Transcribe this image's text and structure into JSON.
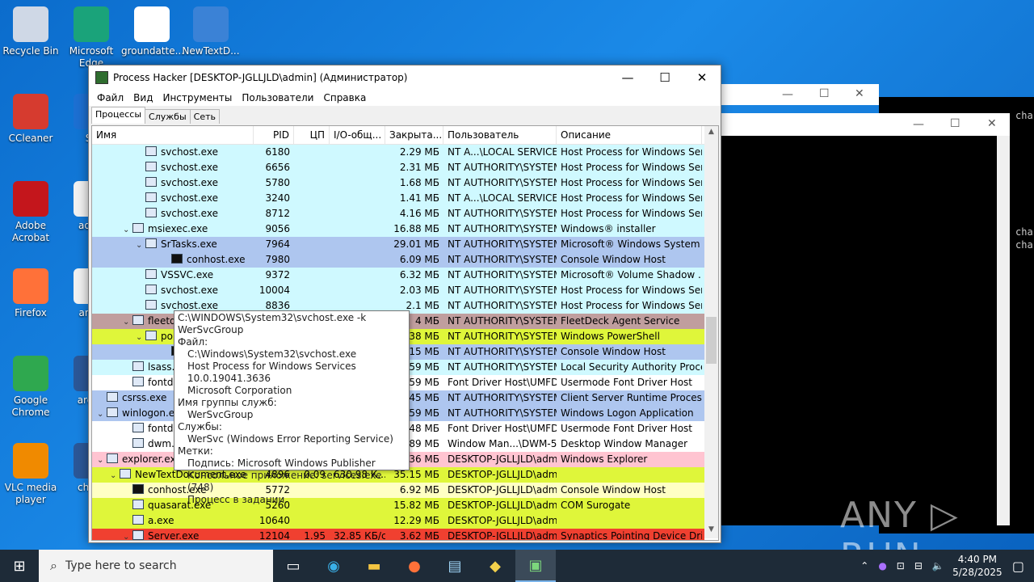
{
  "desktop": {
    "icons": [
      {
        "label": "Recycle Bin",
        "color": "#cfd8e6"
      },
      {
        "label": "Microsoft Edge",
        "color": "#1aa37a"
      },
      {
        "label": "groundatte...",
        "color": "#ffffff"
      },
      {
        "label": "NewTextD...",
        "color": "#3b82d6"
      },
      {
        "label": "CCleaner",
        "color": "#d63b2f"
      },
      {
        "label": "Sk",
        "color": "#1c6fd1"
      },
      {
        "label": "Adobe Acrobat",
        "color": "#c4161c"
      },
      {
        "label": "advic",
        "color": "#f0f0f0"
      },
      {
        "label": "Firefox",
        "color": "#ff7139"
      },
      {
        "label": "answ",
        "color": "#f0f0f0"
      },
      {
        "label": "Google Chrome",
        "color": "#2fa84f"
      },
      {
        "label": "aroun",
        "color": "#2b5797"
      },
      {
        "label": "VLC media player",
        "color": "#f08a00"
      },
      {
        "label": "charg",
        "color": "#2b5797"
      }
    ],
    "console_text": [
      "cha",
      "cha",
      "cha"
    ]
  },
  "window": {
    "title": "Process Hacker [DESKTOP-JGLLJLD\\admin] (Администратор)",
    "controls": {
      "minimize": "—",
      "maximize": "☐",
      "close": "✕"
    },
    "menu": [
      "Файл",
      "Вид",
      "Инструменты",
      "Пользователи",
      "Справка"
    ],
    "tabs": [
      "Процессы",
      "Службы",
      "Сеть"
    ],
    "columns": [
      "Имя",
      "PID",
      "ЦП",
      "I/O-общ...",
      "Закрыта...",
      "Пользователь",
      "Описание"
    ]
  },
  "rows": [
    {
      "name": "svchost.exe",
      "indent": 3,
      "exp": "",
      "pid": "6180",
      "cpu": "",
      "io": "",
      "mem": "2.29 МБ",
      "user": "NT A...\\LOCAL SERVICE",
      "desc": "Host Process for Windows Ser...",
      "bg": "#cff9ff",
      "icon": "svc"
    },
    {
      "name": "svchost.exe",
      "indent": 3,
      "exp": "",
      "pid": "6656",
      "cpu": "",
      "io": "",
      "mem": "2.31 МБ",
      "user": "NT AUTHORITY\\SYSTEM",
      "desc": "Host Process for Windows Ser...",
      "bg": "#cff9ff",
      "icon": "svc"
    },
    {
      "name": "svchost.exe",
      "indent": 3,
      "exp": "",
      "pid": "5780",
      "cpu": "",
      "io": "",
      "mem": "1.68 МБ",
      "user": "NT AUTHORITY\\SYSTEM",
      "desc": "Host Process for Windows Ser...",
      "bg": "#cff9ff",
      "icon": "svc"
    },
    {
      "name": "svchost.exe",
      "indent": 3,
      "exp": "",
      "pid": "3240",
      "cpu": "",
      "io": "",
      "mem": "1.41 МБ",
      "user": "NT A...\\LOCAL SERVICE",
      "desc": "Host Process for Windows Ser...",
      "bg": "#cff9ff",
      "icon": "svc"
    },
    {
      "name": "svchost.exe",
      "indent": 3,
      "exp": "",
      "pid": "8712",
      "cpu": "",
      "io": "",
      "mem": "4.16 МБ",
      "user": "NT AUTHORITY\\SYSTEM",
      "desc": "Host Process for Windows Ser...",
      "bg": "#cff9ff",
      "icon": "svc"
    },
    {
      "name": "msiexec.exe",
      "indent": 2,
      "exp": "v",
      "pid": "9056",
      "cpu": "",
      "io": "",
      "mem": "16.88 МБ",
      "user": "NT AUTHORITY\\SYSTEM",
      "desc": "Windows® installer",
      "bg": "#cff9ff",
      "icon": "svc"
    },
    {
      "name": "SrTasks.exe",
      "indent": 3,
      "exp": "v",
      "pid": "7964",
      "cpu": "",
      "io": "",
      "mem": "29.01 МБ",
      "user": "NT AUTHORITY\\SYSTEM",
      "desc": "Microsoft® Windows System ...",
      "bg": "#aec6ef",
      "icon": "svc"
    },
    {
      "name": "conhost.exe",
      "indent": 5,
      "exp": "",
      "pid": "7980",
      "cpu": "",
      "io": "",
      "mem": "6.09 МБ",
      "user": "NT AUTHORITY\\SYSTEM",
      "desc": "Console Window Host",
      "bg": "#aec6ef",
      "icon": "con"
    },
    {
      "name": "VSSVC.exe",
      "indent": 3,
      "exp": "",
      "pid": "9372",
      "cpu": "",
      "io": "",
      "mem": "6.32 МБ",
      "user": "NT AUTHORITY\\SYSTEM",
      "desc": "Microsoft® Volume Shadow ...",
      "bg": "#cff9ff",
      "icon": "svc"
    },
    {
      "name": "svchost.exe",
      "indent": 3,
      "exp": "",
      "pid": "10004",
      "cpu": "",
      "io": "",
      "mem": "2.03 МБ",
      "user": "NT AUTHORITY\\SYSTEM",
      "desc": "Host Process for Windows Ser...",
      "bg": "#cff9ff",
      "icon": "svc"
    },
    {
      "name": "svchost.exe",
      "indent": 3,
      "exp": "",
      "pid": "8836",
      "cpu": "",
      "io": "",
      "mem": "2.1 МБ",
      "user": "NT AUTHORITY\\SYSTEM",
      "desc": "Host Process for Windows Ser...",
      "bg": "#cff9ff",
      "icon": "svc"
    },
    {
      "name": "fleetd",
      "indent": 2,
      "exp": "v",
      "pid": "",
      "cpu": "",
      "io": "",
      "mem": "4 МБ",
      "user": "NT AUTHORITY\\SYSTEM",
      "desc": "FleetDeck Agent Service",
      "bg": "#c09e9e",
      "icon": "svc"
    },
    {
      "name": "po",
      "indent": 3,
      "exp": "v",
      "pid": "",
      "cpu": "",
      "io": "",
      "mem": "38 МБ",
      "user": "NT AUTHORITY\\SYSTEM",
      "desc": "Windows PowerShell",
      "bg": "#dff63a",
      "icon": "svc"
    },
    {
      "name": "",
      "indent": 5,
      "exp": "",
      "pid": "",
      "cpu": "",
      "io": "",
      "mem": "15 МБ",
      "user": "NT AUTHORITY\\SYSTEM",
      "desc": "Console Window Host",
      "bg": "#aec6ef",
      "icon": "con"
    },
    {
      "name": "lsass.exe",
      "indent": 2,
      "exp": "",
      "pid": "",
      "cpu": "",
      "io": "",
      "mem": "59 МБ",
      "user": "NT AUTHORITY\\SYSTEM",
      "desc": "Local Security Authority Proce...",
      "bg": "#cff9ff",
      "icon": "svc"
    },
    {
      "name": "fontdrvh",
      "indent": 2,
      "exp": "",
      "pid": "",
      "cpu": "",
      "io": "",
      "mem": "59 МБ",
      "user": "Font Driver Host\\UMFD-",
      "desc": "Usermode Font Driver Host",
      "bg": "#ffffff",
      "icon": "svc"
    },
    {
      "name": "csrss.exe",
      "indent": 0,
      "exp": "",
      "pid": "",
      "cpu": "",
      "io": "",
      "mem": "45 МБ",
      "user": "NT AUTHORITY\\SYSTEM",
      "desc": "Client Server Runtime Process",
      "bg": "#aec6ef",
      "icon": "svc"
    },
    {
      "name": "winlogon.e",
      "indent": 0,
      "exp": "v",
      "pid": "",
      "cpu": "",
      "io": "",
      "mem": "59 МБ",
      "user": "NT AUTHORITY\\SYSTEM",
      "desc": "Windows Logon Application",
      "bg": "#aec6ef",
      "icon": "svc"
    },
    {
      "name": "fontdrvh",
      "indent": 2,
      "exp": "",
      "pid": "",
      "cpu": "",
      "io": "",
      "mem": "48 МБ",
      "user": "Font Driver Host\\UMFD-",
      "desc": "Usermode Font Driver Host",
      "bg": "#ffffff",
      "icon": "svc"
    },
    {
      "name": "dwm.ex",
      "indent": 2,
      "exp": "",
      "pid": "",
      "cpu": "",
      "io": "",
      "mem": "89 МБ",
      "user": "Window Man...\\DWM-5",
      "desc": "Desktop Window Manager",
      "bg": "#ffffff",
      "icon": "svc"
    },
    {
      "name": "explorer.ex",
      "indent": 0,
      "exp": "v",
      "pid": "",
      "cpu": "",
      "io": "",
      "mem": "36 МБ",
      "user": "DESKTOP-JGLLJLD\\admi",
      "desc": "Windows Explorer",
      "bg": "#ffc4d1",
      "icon": "svc"
    },
    {
      "name": "NewTextDocument.exe",
      "indent": 1,
      "exp": "v",
      "pid": "4896",
      "cpu": "0.09",
      "io": "630.98 К...",
      "mem": "35.15 МБ",
      "user": "DESKTOP-JGLLJLD\\admi",
      "desc": "",
      "bg": "#dff63a",
      "icon": "svc"
    },
    {
      "name": "conhost.exe",
      "indent": 2,
      "exp": "",
      "pid": "5772",
      "cpu": "",
      "io": "",
      "mem": "6.92 МБ",
      "user": "DESKTOP-JGLLJLD\\admi",
      "desc": "Console Window Host",
      "bg": "#ffffc4",
      "icon": "con"
    },
    {
      "name": "quasarat.exe",
      "indent": 2,
      "exp": "",
      "pid": "5260",
      "cpu": "",
      "io": "",
      "mem": "15.82 МБ",
      "user": "DESKTOP-JGLLJLD\\admi",
      "desc": "COM Surogate",
      "bg": "#dff63a",
      "icon": "svc"
    },
    {
      "name": "a.exe",
      "indent": 2,
      "exp": "",
      "pid": "10640",
      "cpu": "",
      "io": "",
      "mem": "12.29 МБ",
      "user": "DESKTOP-JGLLJLD\\admi",
      "desc": "",
      "bg": "#dff63a",
      "icon": "svc"
    },
    {
      "name": "Server.exe",
      "indent": 2,
      "exp": "v",
      "pid": "12104",
      "cpu": "1.95",
      "io": "32.85 КБ/с",
      "mem": "3.62 МБ",
      "user": "DESKTOP-JGLLJLD\\admi",
      "desc": "Synaptics Pointing Device Dri...",
      "bg": "#f04030",
      "icon": "svc"
    }
  ],
  "tooltip": {
    "lines": [
      {
        "t": "C:\\WINDOWS\\System32\\svchost.exe -k WerSvcGroup",
        "i": false
      },
      {
        "t": "Файл:",
        "i": false
      },
      {
        "t": "C:\\Windows\\System32\\svchost.exe",
        "i": true
      },
      {
        "t": "Host Process for Windows Services 10.0.19041.3636",
        "i": true
      },
      {
        "t": "Microsoft Corporation",
        "i": true
      },
      {
        "t": "Имя группы служб:",
        "i": false
      },
      {
        "t": "WerSvcGroup",
        "i": true
      },
      {
        "t": "Службы:",
        "i": false
      },
      {
        "t": "WerSvc (Windows Error Reporting Service)",
        "i": true
      },
      {
        "t": "Метки:",
        "i": false
      },
      {
        "t": "Подпись: Microsoft Windows Publisher",
        "i": true
      },
      {
        "t": "Консольное приложение: services.exe (748)",
        "i": true
      },
      {
        "t": "Процесс в задании.",
        "i": true
      }
    ]
  },
  "watermark": "ANY ▷ RUN",
  "taskbar": {
    "search_placeholder": "Type here to search",
    "time": "4:40 PM",
    "date": "5/28/2025"
  }
}
